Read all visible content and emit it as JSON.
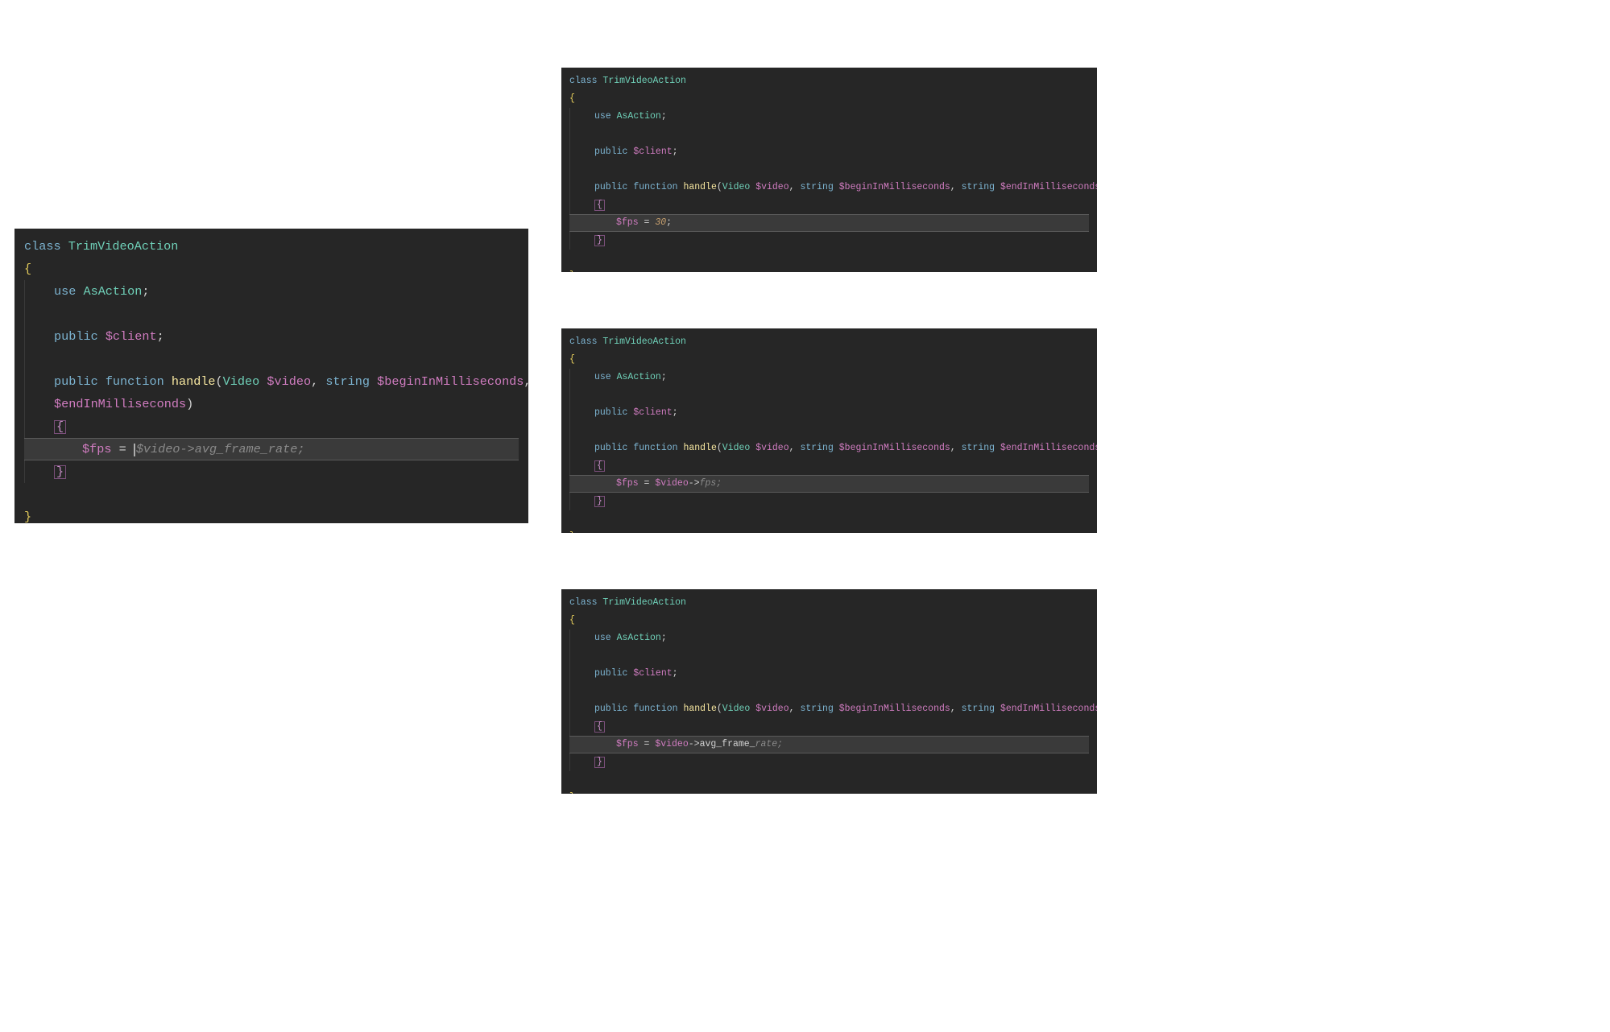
{
  "colors": {
    "bg": "#262626",
    "keyword": "#7cb3d0",
    "class": "#6fd0b8",
    "function": "#f7e7a0",
    "variable": "#d07cc0",
    "braceOuter": "#e0c95a",
    "braceInner": "#c98fc9",
    "number": "#c7a06e",
    "suggestion": "#8a8a8a",
    "highlightLine": "#3a3a3a"
  },
  "common": {
    "kw_class": "class",
    "kw_use": "use",
    "kw_public": "public",
    "kw_function": "function",
    "kw_string": "string",
    "className": "TrimVideoAction",
    "trait": "AsAction",
    "clientDecl": "$client",
    "fnName": "handle",
    "paramType1": "Video",
    "param1": "$video",
    "param2": "$beginInMilliseconds",
    "param3": "$endInMilliseconds",
    "fpsVar": "$fps",
    "semicolon": ";",
    "comma": ",",
    "eq": " = ",
    "openParen": "(",
    "closeParen": ")",
    "openBrace": "{",
    "closeBrace": "}"
  },
  "editors": {
    "left": {
      "fpsAssignPrefix": "$fps = ",
      "fpsSuggestion": "$video->avg_frame_rate;",
      "hasCaret": true,
      "wrappedSignature": true
    },
    "r1": {
      "fpsAssignPrefix": "$fps = ",
      "fpsNumber": "30",
      "fpsSuffix": ";"
    },
    "r2": {
      "fpsAssignPrefix": "$fps = $video->",
      "fpsSuggestion": "fps;",
      "fpsPre_var": "$video",
      "fpsPre_arrow": "->"
    },
    "r3": {
      "fpsAssignPrefix": "$fps = $video->avg_frame_",
      "fpsSuggestion": "rate;",
      "fpsPre_var": "$video",
      "fpsPre_arrow": "->",
      "fpsPre_typed": "avg_frame_"
    }
  }
}
